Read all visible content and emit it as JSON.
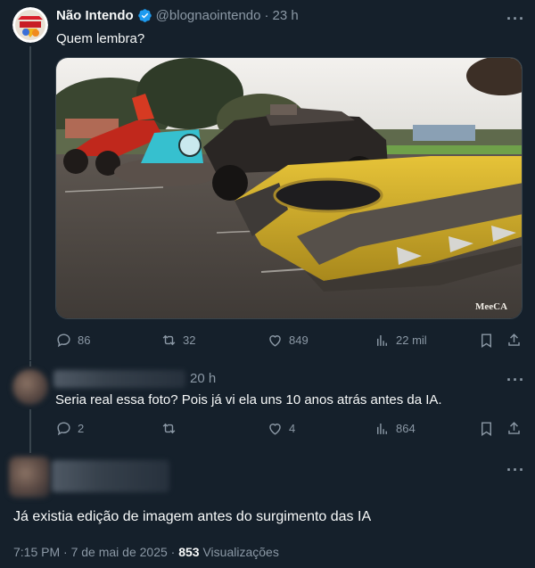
{
  "main_tweet": {
    "display_name": "Não Intendo",
    "handle": "@blognaointendo",
    "separator": "·",
    "time": "23 h",
    "text": "Quem lembra?",
    "media_watermark": "MeeCA",
    "actions": {
      "replies": "86",
      "retweets": "32",
      "likes": "849",
      "views": "22 mil"
    }
  },
  "reply_tweet": {
    "time": "20 h",
    "text": "Seria real essa foto? Pois já vi ela uns 10 anos atrás antes da IA.",
    "actions": {
      "replies": "2",
      "retweets": "",
      "likes": "4",
      "views": "864"
    }
  },
  "focused_tweet": {
    "text": "Já existia edição de imagem antes do surgimento das IA",
    "timestamp": "7:15 PM · 7 de mai de 2025 ·",
    "views_count": "853",
    "views_label": "Visualizações"
  },
  "more_glyph": "···",
  "colors": {
    "background": "#15202b",
    "text": "#f7f9f9",
    "secondary": "#8b98a5",
    "border": "#38444d",
    "verified": "#1d9bf0"
  }
}
